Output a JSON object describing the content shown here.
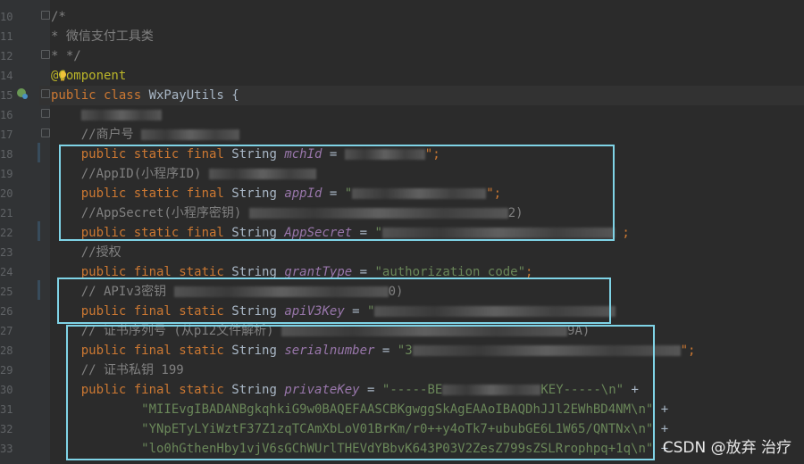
{
  "editor": {
    "lines": [
      {
        "n": "10",
        "parts": [
          {
            "t": "/*",
            "c": "cmt"
          }
        ]
      },
      {
        "n": "11",
        "parts": [
          {
            "t": "* 微信支付工具类",
            "c": "cmt"
          }
        ]
      },
      {
        "n": "12",
        "parts": [
          {
            "t": "* */",
            "c": "cmt"
          }
        ]
      },
      {
        "n": "14",
        "parts": [
          {
            "t": "@Component",
            "c": "ann"
          }
        ]
      },
      {
        "n": "15",
        "parts": [
          {
            "t": "public class ",
            "c": "kw"
          },
          {
            "t": "WxPayUtils",
            "c": "cls"
          },
          {
            "t": " {",
            "c": "cls"
          }
        ]
      },
      {
        "n": "16",
        "parts": [
          {
            "t": "    ",
            "c": "cls"
          },
          {
            "blur": 90
          }
        ]
      },
      {
        "n": "17",
        "parts": [
          {
            "t": "    //商户号 ",
            "c": "cmt"
          },
          {
            "blur": 110
          }
        ]
      },
      {
        "n": "18",
        "parts": [
          {
            "t": "    public static final ",
            "c": "kw"
          },
          {
            "t": "String ",
            "c": "cls"
          },
          {
            "t": "mchId",
            "c": "fld"
          },
          {
            "t": " = ",
            "c": "cls"
          },
          {
            "blur": 90
          },
          {
            "t": "\";",
            "c": "kw"
          }
        ]
      },
      {
        "n": "19",
        "parts": [
          {
            "t": "    //AppID(小程序ID) ",
            "c": "cmt"
          },
          {
            "blur": 120
          }
        ]
      },
      {
        "n": "20",
        "parts": [
          {
            "t": "    public static final ",
            "c": "kw"
          },
          {
            "t": "String ",
            "c": "cls"
          },
          {
            "t": "appId",
            "c": "fld"
          },
          {
            "t": " = ",
            "c": "cls"
          },
          {
            "t": "\"",
            "c": "str"
          },
          {
            "blur": 150
          },
          {
            "t": "\";",
            "c": "kw"
          }
        ]
      },
      {
        "n": "21",
        "parts": [
          {
            "t": "    //AppSecret(小程序密钥) ",
            "c": "cmt"
          },
          {
            "blur": 290
          },
          {
            "t": "2)",
            "c": "cmt"
          }
        ]
      },
      {
        "n": "22",
        "parts": [
          {
            "t": "    public static final ",
            "c": "kw"
          },
          {
            "t": "String ",
            "c": "cls"
          },
          {
            "t": "AppSecret",
            "c": "fld"
          },
          {
            "t": " = ",
            "c": "cls"
          },
          {
            "t": "\"",
            "c": "str"
          },
          {
            "blur": 260
          },
          {
            "t": " ;",
            "c": "kw"
          }
        ]
      },
      {
        "n": "23",
        "parts": [
          {
            "t": "    //授权",
            "c": "cmt"
          }
        ]
      },
      {
        "n": "24",
        "parts": [
          {
            "t": "    public final static ",
            "c": "kw"
          },
          {
            "t": "String ",
            "c": "cls"
          },
          {
            "t": "grantType",
            "c": "fld"
          },
          {
            "t": " = ",
            "c": "cls"
          },
          {
            "t": "\"authorization_code\"",
            "c": "str"
          },
          {
            "t": ";",
            "c": "kw"
          }
        ]
      },
      {
        "n": "25",
        "parts": [
          {
            "t": "    // APIv3密钥 ",
            "c": "cmt"
          },
          {
            "blur": 240
          },
          {
            "t": "0)",
            "c": "cmt"
          }
        ]
      },
      {
        "n": "26",
        "parts": [
          {
            "t": "    public final static ",
            "c": "kw"
          },
          {
            "t": "String ",
            "c": "cls"
          },
          {
            "t": "apiV3Key",
            "c": "fld"
          },
          {
            "t": " = ",
            "c": "cls"
          },
          {
            "t": "\"",
            "c": "str"
          },
          {
            "blur": 270
          }
        ]
      },
      {
        "n": "27",
        "parts": [
          {
            "t": "    // 证书序列号 (从p12文件解析) ",
            "c": "cmt"
          },
          {
            "blur": 320
          },
          {
            "t": "9A)",
            "c": "cmt"
          }
        ]
      },
      {
        "n": "28",
        "parts": [
          {
            "t": "    public final static ",
            "c": "kw"
          },
          {
            "t": "String ",
            "c": "cls"
          },
          {
            "t": "serialnumber",
            "c": "fld"
          },
          {
            "t": " = ",
            "c": "cls"
          },
          {
            "t": "\"3",
            "c": "str"
          },
          {
            "blur": 300
          },
          {
            "t": "\";",
            "c": "kw"
          }
        ]
      },
      {
        "n": "29",
        "parts": [
          {
            "t": "    // 证书私钥 199",
            "c": "cmt"
          }
        ]
      },
      {
        "n": "30",
        "parts": [
          {
            "t": "    public final static ",
            "c": "kw"
          },
          {
            "t": "String ",
            "c": "cls"
          },
          {
            "t": "privateKey",
            "c": "fld"
          },
          {
            "t": " = ",
            "c": "cls"
          },
          {
            "t": "\"-----BE",
            "c": "str"
          },
          {
            "blur": 110
          },
          {
            "t": "KEY-----\\n\"",
            "c": "str"
          },
          {
            "t": " +",
            "c": "cls"
          }
        ]
      },
      {
        "n": "31",
        "parts": [
          {
            "t": "            \"MIIEvgIBADANBgkqhkiG9w0BAQEFAASCBKgwggSkAgEAAoIBAQDhJJl2EWhBD4NM\\n\"",
            "c": "str"
          },
          {
            "t": " +",
            "c": "cls"
          }
        ]
      },
      {
        "n": "32",
        "parts": [
          {
            "t": "            \"YNpETyLYiWztF37Z1zqTCAmXbLoV01BrKm/r0++y4oTk7+ububGE6L1W65/QNTNx\\n\"",
            "c": "str"
          },
          {
            "t": " +",
            "c": "cls"
          }
        ]
      },
      {
        "n": "33",
        "parts": [
          {
            "t": "            \"lo0hGthenHby1vjV6sGChWUrlTHEVdYBbvK643P03V2ZesZ799sZSLRrophpq+1q\\n\"",
            "c": "str"
          },
          {
            "t": " +",
            "c": "cls"
          }
        ]
      }
    ]
  },
  "watermark": {
    "text": "CSDN @放弃    治疗"
  },
  "colors": {
    "highlight_box": "#7fd3e6",
    "background": "#2b2b2b",
    "gutter": "#313335"
  }
}
